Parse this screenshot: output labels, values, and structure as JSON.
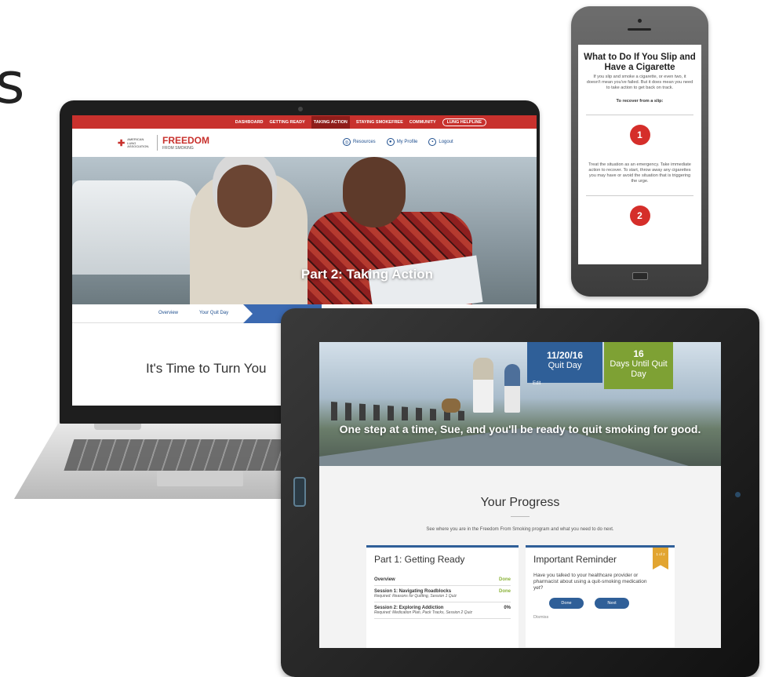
{
  "page": {
    "cut_letter": "s"
  },
  "laptop": {
    "nav": {
      "items": [
        "DASHBOARD",
        "GETTING READY",
        "TAKING ACTION",
        "STAYING SMOKEFREE",
        "COMMUNITY"
      ],
      "helpline": "LUNG HELPLINE"
    },
    "logo_ala": {
      "line1": "AMERICAN",
      "line2": "LUNG",
      "line3": "ASSOCIATION."
    },
    "logo_ffs": {
      "main": "FREEDOM",
      "sub": "FROM SMOKING"
    },
    "header_links": [
      {
        "label": "Resources",
        "icon": "globe-icon"
      },
      {
        "label": "My Profile",
        "icon": "user-icon"
      },
      {
        "label": "Logout",
        "icon": "lock-icon"
      }
    ],
    "hero_title": "Part 2: Taking Action",
    "tabs": [
      "Overview",
      "Your Quit Day"
    ],
    "big_heading": "It's Time to Turn You"
  },
  "phone": {
    "title": "What to Do If You Slip and Have a Cigarette",
    "intro": "If you slip and smoke a cigarette, or even two, it doesn't mean you've failed. But it does mean you need to take action to get back on track.",
    "recover_label": "To recover from a slip:",
    "step1_num": "1",
    "step1_text": "Treat the situation as an emergency. Take immediate action to recover. To start, throw away any cigarettes you may have or avoid the situation that is triggering the urge.",
    "step2_num": "2"
  },
  "tablet": {
    "quit_date": "11/20/16",
    "quit_label": "Quit Day",
    "edit_label": "Edit",
    "days_count": "16",
    "days_label": "Days Until Quit Day",
    "hero_text": "One step at a time, Sue, and you'll be ready to quit smoking for good.",
    "progress_title": "Your Progress",
    "progress_sub": "See where you are in the Freedom From Smoking program and what you need to do next.",
    "card1": {
      "title": "Part 1: Getting Ready",
      "rows": [
        {
          "name": "Overview",
          "detail": "",
          "status": "Done"
        },
        {
          "name": "Session 1: Navigating Roadblocks",
          "detail": "Required: Reasons for Quitting, Session 1 Quiz",
          "status": "Done"
        },
        {
          "name": "Session 2: Exploring Addiction",
          "detail": "Required: Medication Plan, Pack Tracks, Session 2 Quiz",
          "status": "0%"
        }
      ]
    },
    "card2": {
      "title": "Important Reminder",
      "badge": "1 of 2",
      "body": "Have you talked to your healthcare provider or pharmacist about using a quit-smoking medication yet?",
      "btn1": "Done",
      "btn2": "Next",
      "dismiss": "Dismiss"
    }
  }
}
